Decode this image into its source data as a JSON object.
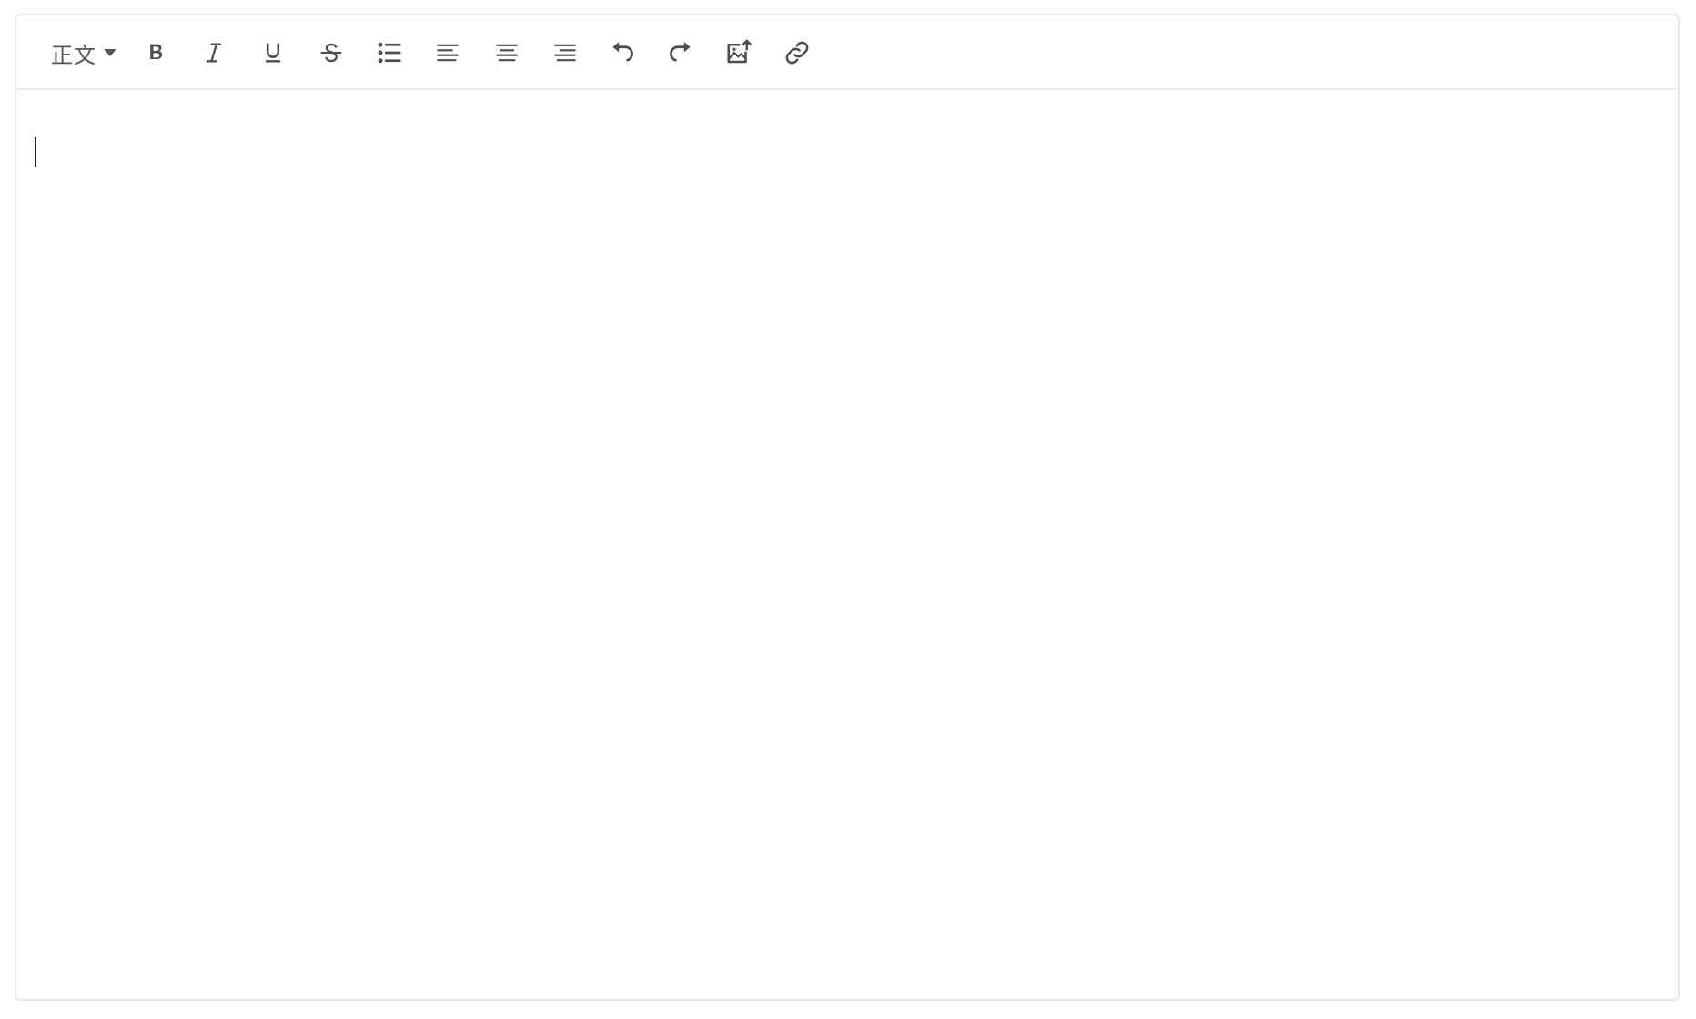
{
  "editor": {
    "toolbar": {
      "heading_select": {
        "value": "正文"
      },
      "buttons": [
        {
          "name": "bold",
          "icon": "bold-icon"
        },
        {
          "name": "italic",
          "icon": "italic-icon"
        },
        {
          "name": "underline",
          "icon": "underline-icon"
        },
        {
          "name": "strikethrough",
          "icon": "strikethrough-icon"
        },
        {
          "name": "bulleted-list",
          "icon": "bulleted-list-icon"
        },
        {
          "name": "align-left",
          "icon": "align-left-icon"
        },
        {
          "name": "align-center",
          "icon": "align-center-icon"
        },
        {
          "name": "align-right",
          "icon": "align-right-icon"
        },
        {
          "name": "undo",
          "icon": "undo-icon"
        },
        {
          "name": "redo",
          "icon": "redo-icon"
        },
        {
          "name": "insert-image",
          "icon": "image-upload-icon"
        },
        {
          "name": "insert-link",
          "icon": "link-icon"
        }
      ]
    },
    "content": {
      "text": ""
    }
  },
  "colors": {
    "icon": "#4d4d4d",
    "border": "#e6e6e6",
    "divider": "#ececec",
    "cursor": "#222222"
  }
}
